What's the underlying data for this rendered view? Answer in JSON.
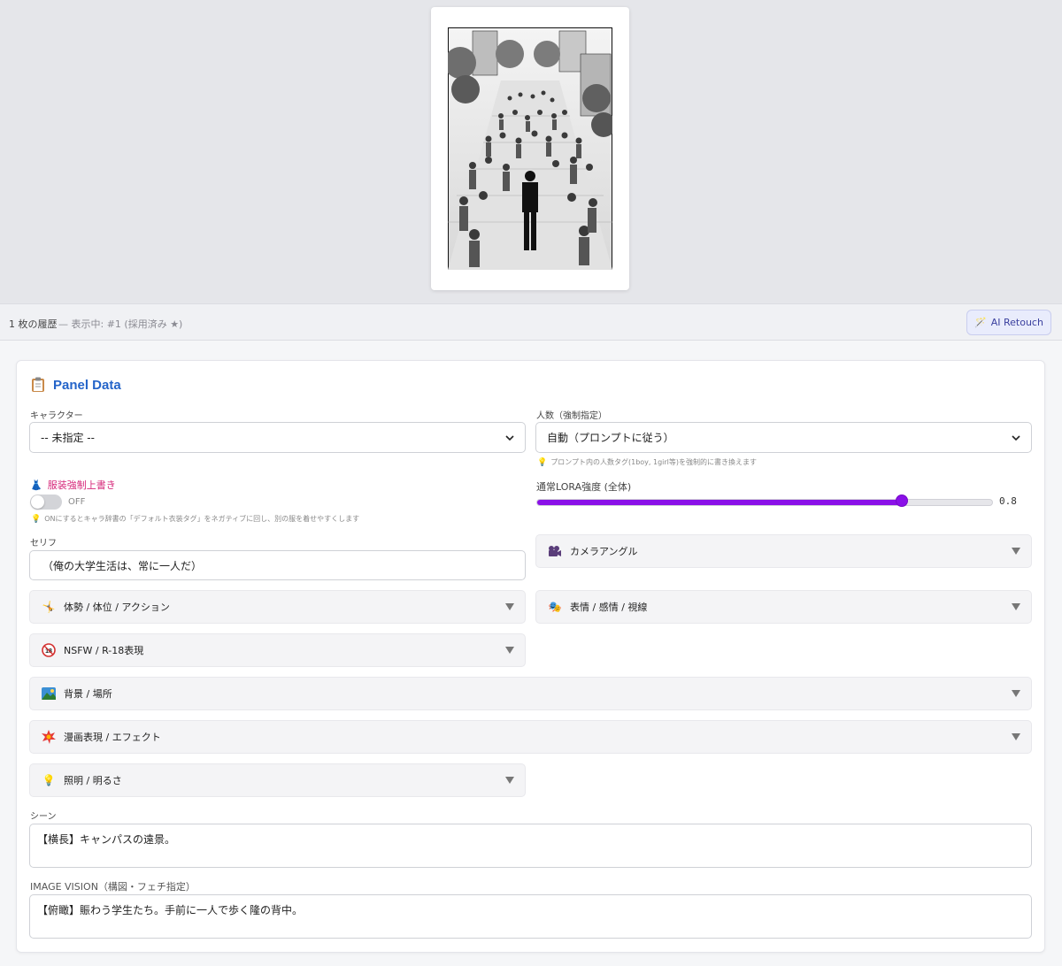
{
  "history": {
    "count_text": "1 枚の履歴",
    "status_text": "— 表示中: #1 (採用済み ★)",
    "retouch_label": "AI Retouch"
  },
  "panel": {
    "title": "Panel Data",
    "character": {
      "label": "キャラクター",
      "value": "-- 未指定 --"
    },
    "people_count": {
      "label": "人数（強制指定）",
      "value": "自動（プロンプトに従う）",
      "hint": "プロンプト内の人数タグ(1boy, 1girl等)を強制的に書き換えます"
    },
    "outfit_override": {
      "label": "服装強制上書き",
      "state": "OFF",
      "hint": "ONにするとキャラ辞書の「デフォルト衣装タグ」をネガティブに回し、別の服を着せやすくします"
    },
    "lora": {
      "label": "通常LORA強度 (全体)",
      "value": "0.8",
      "fraction": 0.8
    },
    "serif": {
      "label": "セリフ",
      "value": "（俺の大学生活は、常に一人だ）"
    },
    "accordions": {
      "camera": "カメラアングル",
      "pose": "体勢 / 体位 / アクション",
      "expression": "表情 / 感情 / 視線",
      "nsfw": "NSFW / R-18表現",
      "background": "背景 / 場所",
      "manga": "漫画表現 / エフェクト",
      "lighting": "照明 / 明るさ"
    },
    "scene": {
      "label": "シーン",
      "value": "【横長】キャンパスの遠景。"
    },
    "image_vision": {
      "label": "IMAGE VISION（構図・フェチ指定）",
      "value": "【俯瞰】賑わう学生たち。手前に一人で歩く隆の背中。"
    }
  },
  "colors": {
    "accent": "#8a10e8",
    "title": "#2464c9",
    "override": "#d6287a"
  }
}
